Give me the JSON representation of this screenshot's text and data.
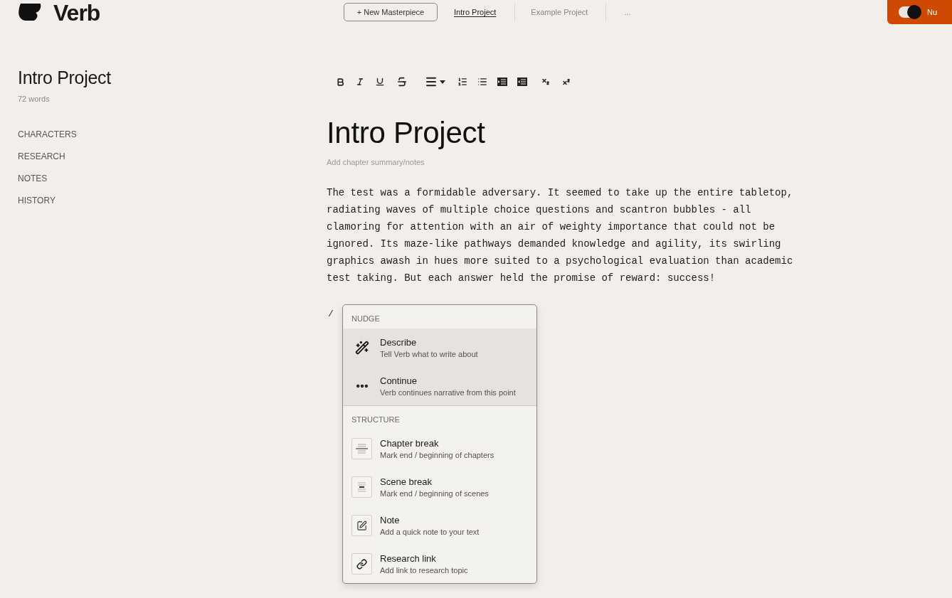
{
  "header": {
    "logo": "Verb",
    "new_button": "+ New Masterpiece",
    "tabs": [
      {
        "label": "Intro Project",
        "selected": true
      },
      {
        "label": "Example Project",
        "selected": false
      }
    ],
    "more": "...",
    "action_button": "Nu"
  },
  "sidebar": {
    "title": "Intro Project",
    "word_count": "72 words",
    "items": [
      "CHARACTERS",
      "RESEARCH",
      "NOTES",
      "HISTORY"
    ]
  },
  "editor": {
    "title": "Intro Project",
    "summary": {
      "placeholder": "Add chapter summary/notes"
    },
    "body": "The test was a formidable adversary. It seemed to take up the entire tabletop, radiating waves of multiple choice questions and scantron bubbles - all clamoring for attention with an air of weighty importance that could not be ignored. Its maze-like pathways demanded knowledge and agility, its swirling graphics awash in hues more suited to a psychological evaluation than academic test taking. But each answer held the promise of reward: success!",
    "input_line": "/",
    "menu": {
      "sections": [
        {
          "label": "NUDGE",
          "items": [
            {
              "title": "Describe",
              "description": "Tell Verb what to write about",
              "highlighted": true
            },
            {
              "title": "Continue",
              "description": "Verb continues narrative from this point",
              "highlighted": true
            }
          ]
        },
        {
          "label": "STRUCTURE",
          "items": [
            {
              "title": "Chapter break",
              "description": "Mark end / beginning of chapters",
              "highlighted": false
            },
            {
              "title": "Scene break",
              "description": "Mark end / beginning of scenes",
              "highlighted": false
            },
            {
              "title": "Note",
              "description": "Add a quick note to your text",
              "highlighted": false
            },
            {
              "title": "Research link",
              "description": "Add link to research topic",
              "highlighted": false
            }
          ]
        }
      ]
    }
  }
}
